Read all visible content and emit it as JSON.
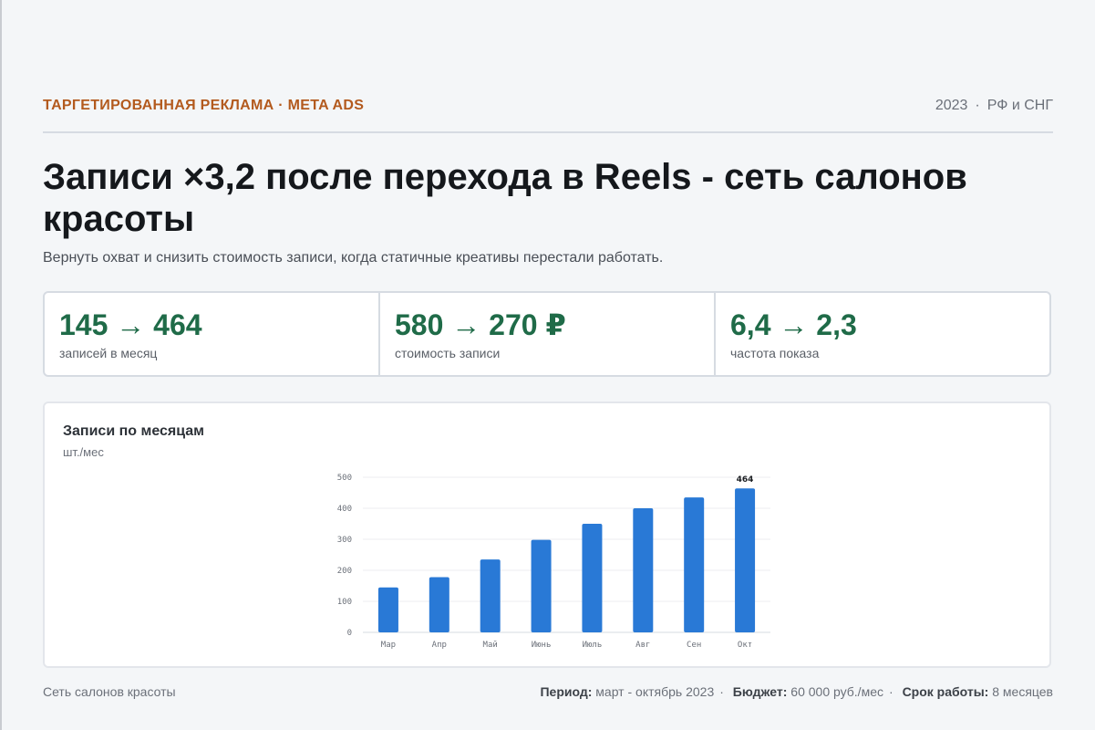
{
  "header": {
    "eyebrow": "ТАРГЕТИРОВАННАЯ РЕКЛАМА · META ADS",
    "year": "2023",
    "region": "РФ и СНГ"
  },
  "hero": {
    "title": "Записи ×3,2 после перехода в Reels - сеть салонов красоты",
    "subtitle": "Вернуть охват и снизить стоимость записи, когда статичные креативы перестали работать."
  },
  "kpis": [
    {
      "value": "145 → 464",
      "label": "записей в месяц"
    },
    {
      "value": "580 → 270 ₽",
      "label": "стоимость записи"
    },
    {
      "value": "6,4 → 2,3",
      "label": "частота показа"
    }
  ],
  "chart": {
    "title": "Записи по месяцам",
    "unit": "шт./мес"
  },
  "chart_data": {
    "type": "bar",
    "categories": [
      "Мар",
      "Апр",
      "Май",
      "Июнь",
      "Июль",
      "Авг",
      "Сен",
      "Окт"
    ],
    "values": [
      145,
      178,
      235,
      298,
      350,
      400,
      435,
      464
    ],
    "ylim": [
      0,
      500
    ],
    "yticks": [
      0,
      100,
      200,
      300,
      400,
      500
    ],
    "data_labels": {
      "Окт": "464"
    },
    "grid": true,
    "bar_color": "#2979d6"
  },
  "footer": {
    "client": "Сеть салонов красоты",
    "period_label": "Период:",
    "period_value": "март - октябрь 2023",
    "budget_label": "Бюджет:",
    "budget_value": "60 000 руб./мес",
    "duration_label": "Срок работы:",
    "duration_value": "8 месяцев"
  },
  "colors": {
    "accent": "#b35a1e",
    "kpi_green": "#1f6b48",
    "bar_blue": "#2979d6"
  }
}
